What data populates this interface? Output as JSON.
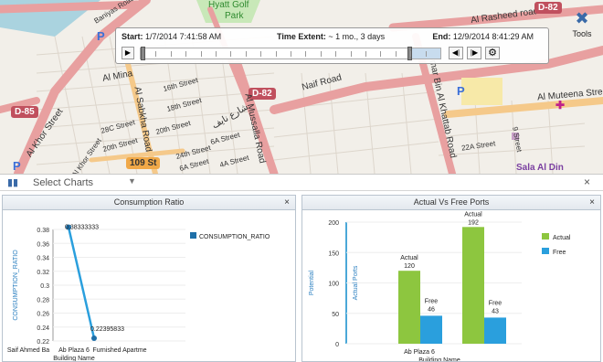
{
  "map": {
    "labels": {
      "baniyas": "Baniyas Road",
      "hyatt": "Hyatt Golf",
      "park": "Park",
      "rasheed": "Al Rasheed road",
      "d82_top": "D-82",
      "al_mina": "Al Mina",
      "d85": "D-85",
      "naif": "Naif Road",
      "d82": "D-82",
      "al_khor": "Al Khor Street",
      "sabkha": "Al Sabkha Road",
      "mussalla": "Al Mussalla Road",
      "khattab": "Omar Bin Al Khattab Road",
      "muteena": "Al Muteena Street",
      "sala": "Sala Al Din",
      "16th": "16th Street",
      "18th": "18th Street",
      "20th": "20th Street",
      "20th_b": "20th Street",
      "28c": "28C Street",
      "24th": "24th Street",
      "khor_st": "Al Khor Street",
      "109": "109 St",
      "6a": "6A Street",
      "6a_b": "6A Street",
      "4a": "4A Street",
      "22a": "22A Street",
      "9th": "9 Street",
      "arabic": "شارع نايف"
    }
  },
  "timeslider": {
    "start_label": "Start:",
    "start_value": "1/7/2014 7:41:58 AM",
    "extent_label": "Time Extent:",
    "extent_value": "~ 1 mo., 3 days",
    "end_label": "End:",
    "end_value": "12/9/2014 8:41:29 AM",
    "progress": 0.1
  },
  "tools": {
    "label": "Tools",
    "icon": "tools-icon"
  },
  "panel": {
    "title": "Select Charts",
    "icon": "chart-icon",
    "close": "×"
  },
  "charts": {
    "win1": {
      "title": "Consumption Ratio",
      "close": "×"
    },
    "win2": {
      "title": "Actual Vs Free Ports",
      "close": "×"
    }
  },
  "chart_data": [
    {
      "type": "line",
      "title": "Consumption Ratio",
      "xlabel": "Building Name",
      "ylabel": "CONSUMPTION_RATIO",
      "categories": [
        "Saif Ahmed Ba...",
        "Ab Plaza 6",
        "Furnished Apartme"
      ],
      "category_labels_display": [
        "Saif Ahmed Ba",
        "Ab Plaza 6",
        "Furnished Apartme"
      ],
      "series": [
        {
          "name": "CONSUMPTION_RATIO",
          "values": [
            0.383333,
            0.223958
          ]
        }
      ],
      "data_labels": [
        "0.38333333",
        "0.22395833"
      ],
      "yticks": [
        "0.38",
        "0.36",
        "0.34",
        "0.32",
        "0.3",
        "0.28",
        "0.26",
        "0.24",
        "0.22"
      ],
      "ylim": [
        0.22,
        0.38
      ]
    },
    {
      "type": "bar",
      "title": "Actual Vs Free Ports",
      "xlabel": "Building Name",
      "ylabel": "Actual Ports",
      "y2label": "Potential",
      "categories": [
        "Ab Plaza 6",
        ""
      ],
      "series": [
        {
          "name": "Actual",
          "values": [
            120,
            192
          ],
          "color": "#8dc63f"
        },
        {
          "name": "Free",
          "values": [
            46,
            43
          ],
          "color": "#2a9fdd"
        }
      ],
      "yticks": [
        "200",
        "150",
        "100",
        "50",
        "0"
      ],
      "ylim": [
        0,
        200
      ],
      "bar_labels": {
        "actual": "Actual",
        "free": "Free"
      }
    }
  ],
  "legend": {
    "line_series": "CONSUMPTION_RATIO",
    "actual": "Actual",
    "free": "Free"
  }
}
